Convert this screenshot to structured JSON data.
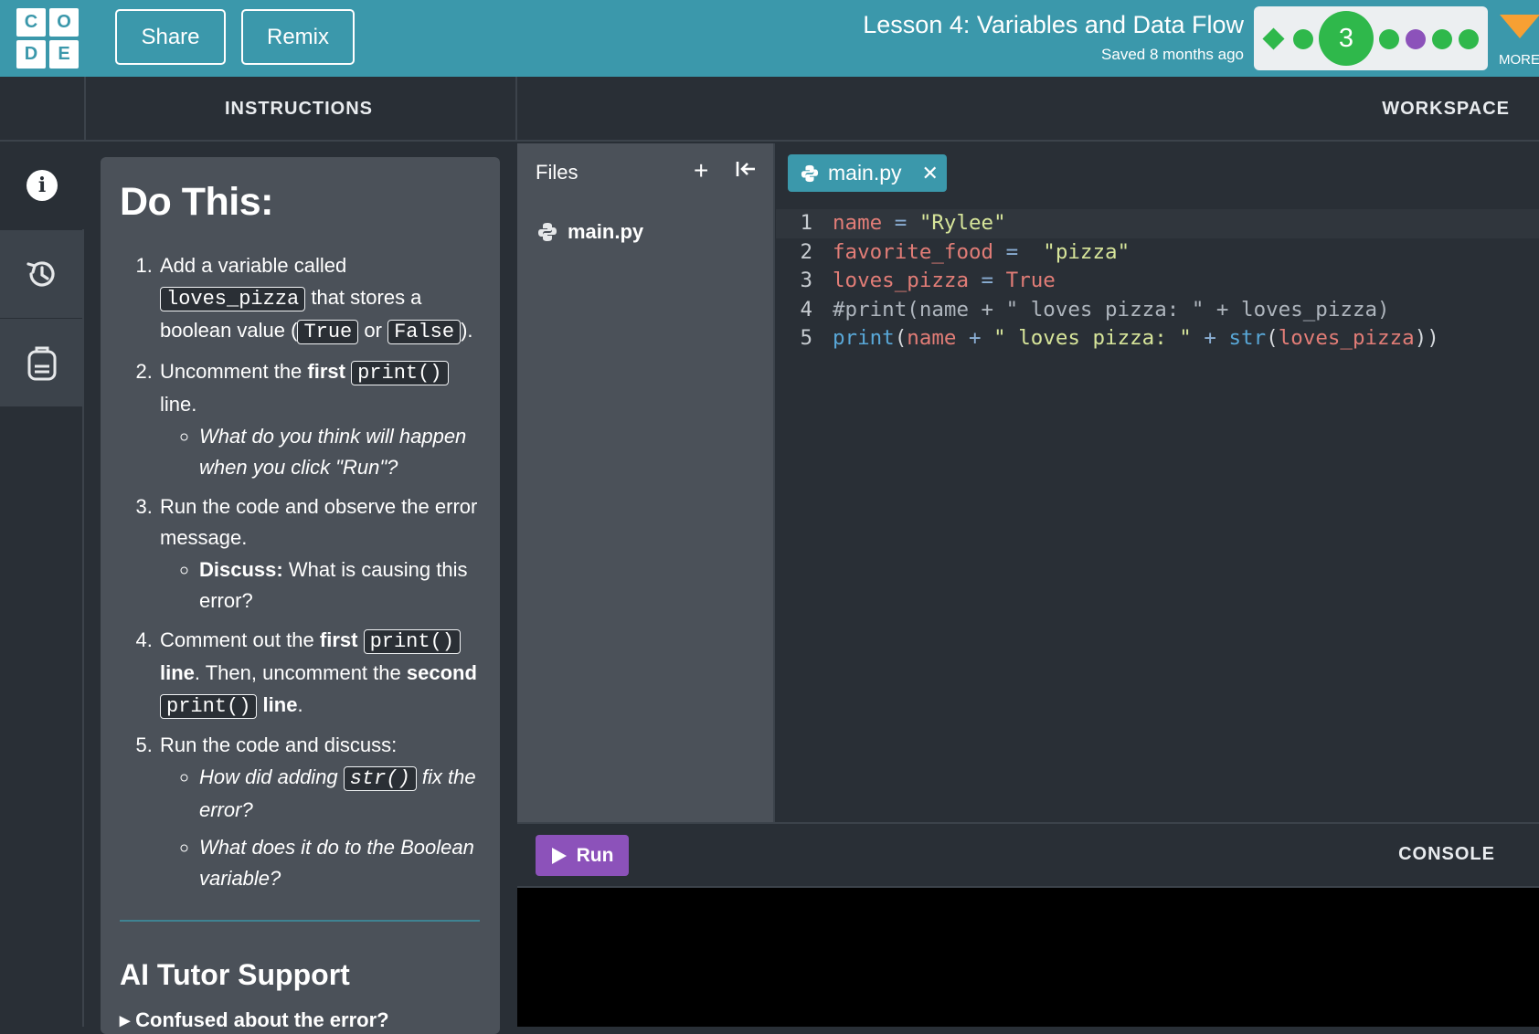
{
  "header": {
    "logo_letters": [
      "C",
      "O",
      "D",
      "E"
    ],
    "share_label": "Share",
    "remix_label": "Remix",
    "lesson_title": "Lesson 4: Variables and Data Flow",
    "saved_status": "Saved 8 months ago",
    "current_level": "3",
    "more_label": "MORE",
    "brand_color": "#3b98ab"
  },
  "sections": {
    "instructions": "INSTRUCTIONS",
    "workspace": "WORKSPACE",
    "console": "CONSOLE"
  },
  "rail": {
    "icons": [
      "info-icon",
      "history-icon",
      "backpack-icon"
    ]
  },
  "instructions": {
    "heading": "Do This:",
    "step1": {
      "a": "Add a variable called ",
      "code1": "loves_pizza",
      "b": " that stores a boolean value (",
      "code2": "True",
      "c": " or ",
      "code3": "False",
      "d": ")."
    },
    "step2": {
      "a": "Uncomment the ",
      "bold": "first",
      "code": "print()",
      "b": " line.",
      "sub1": "What do you think will happen when you click \"Run\"?"
    },
    "step3": {
      "a": "Run the code and observe the error message.",
      "sub_bold": "Discuss:",
      "sub_rest": " What is causing this error?"
    },
    "step4": {
      "a": "Comment out the ",
      "bold1": "first",
      "code1": "print()",
      "bold2": "line",
      "b": ". Then, uncomment the ",
      "bold3": "second",
      "code2": "print()",
      "bold4": "line",
      "c": "."
    },
    "step5": {
      "a": "Run the code and discuss:",
      "sub1a": "How did adding ",
      "sub1code": "str()",
      "sub1b": " fix the error?",
      "sub2": "What does it do to the Boolean variable?"
    },
    "ai_title": "AI Tutor Support",
    "ai_sub": "▸ Confused about the error?"
  },
  "files": {
    "title": "Files",
    "items": [
      {
        "name": "main.py"
      }
    ]
  },
  "editor": {
    "tab_name": "main.py",
    "lines": [
      {
        "n": "1",
        "tokens": [
          [
            "var",
            "name"
          ],
          [
            "op",
            " = "
          ],
          [
            "str",
            "\"Rylee\""
          ]
        ]
      },
      {
        "n": "2",
        "tokens": [
          [
            "var",
            "favorite_food"
          ],
          [
            "op",
            " =  "
          ],
          [
            "str",
            "\"pizza\""
          ]
        ]
      },
      {
        "n": "3",
        "tokens": [
          [
            "var",
            "loves_pizza"
          ],
          [
            "op",
            " = "
          ],
          [
            "var",
            "True"
          ]
        ]
      },
      {
        "n": "4",
        "tokens": [
          [
            "cm",
            "#print(name + \" loves pizza: \" + loves_pizza)"
          ]
        ]
      },
      {
        "n": "5",
        "tokens": [
          [
            "fn",
            "print"
          ],
          [
            "pl",
            "("
          ],
          [
            "var",
            "name"
          ],
          [
            "op",
            " + "
          ],
          [
            "str",
            "\" loves pizza: \""
          ],
          [
            "op",
            " + "
          ],
          [
            "fn",
            "str"
          ],
          [
            "pl",
            "("
          ],
          [
            "var",
            "loves_pizza"
          ],
          [
            "pl",
            "))"
          ]
        ]
      }
    ]
  },
  "run": {
    "label": "Run"
  },
  "progress": {
    "bubbles": [
      "diamond",
      "dot",
      "big",
      "dot",
      "dot-purple",
      "dot",
      "dot"
    ],
    "colors": {
      "green": "#2fb84b",
      "purple": "#8c52ba"
    }
  }
}
